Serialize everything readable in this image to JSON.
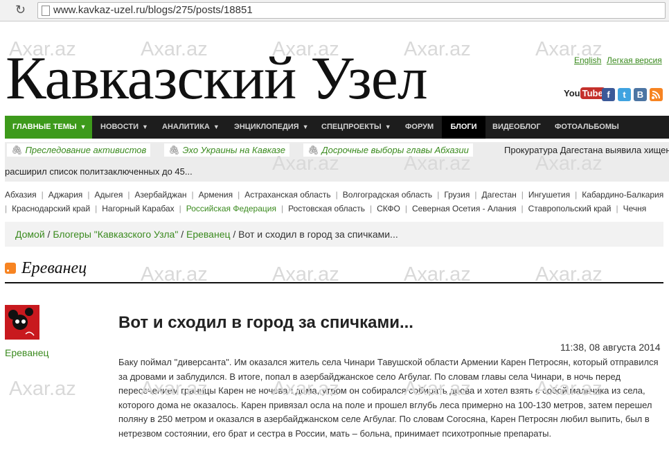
{
  "browser": {
    "url": "www.kavkaz-uzel.ru/blogs/275/posts/18851"
  },
  "watermark": "Axar.az",
  "header": {
    "logo": "Кавказский Узел",
    "lang_english": "English",
    "lang_light": "Легкая версия",
    "social": {
      "youtube_you": "You",
      "youtube_tube": "Tube",
      "facebook": "f",
      "twitter": "t",
      "vk": "B"
    }
  },
  "nav": {
    "items": [
      {
        "label": "ГЛАВНЫЕ ТЕМЫ"
      },
      {
        "label": "НОВОСТИ"
      },
      {
        "label": "АНАЛИТИКА"
      },
      {
        "label": "ЭНЦИКЛОПЕДИЯ"
      },
      {
        "label": "СПЕЦПРОЕКТЫ"
      },
      {
        "label": "ФОРУМ"
      },
      {
        "label": "БЛОГИ"
      },
      {
        "label": "ВИДЕОБЛОГ"
      },
      {
        "label": "ФОТОАЛЬБОМЫ"
      }
    ]
  },
  "ticker": {
    "tags": [
      "Преследование активистов",
      "Эхо Украины на Кавказе",
      "Досрочные выборы главы Абхазии"
    ],
    "news_line1": "Прокуратура Дагестана выявила хищен",
    "news_line2": "расширил список политзаключенных до 45..."
  },
  "regions": {
    "row1": [
      "Абхазия",
      "Аджария",
      "Адыгея",
      "Азербайджан",
      "Армения",
      "Астраханская область",
      "Волгоградская область",
      "Грузия",
      "Дагестан",
      "Ингушетия",
      "Кабардино-Балкария"
    ],
    "row2": [
      "Краснодарский край",
      "Нагорный Карабах",
      "Российская Федерация",
      "Ростовская область",
      "СКФО",
      "Северная Осетия - Алания",
      "Ставропольский край",
      "Чечня"
    ]
  },
  "breadcrumb": {
    "home": "Домой",
    "bloggers": "Блогеры \"Кавказского Узла\"",
    "blog": "Ереванец",
    "current": "Вот и сходил в город за спичками..."
  },
  "blog": {
    "title": "Ереванец"
  },
  "post": {
    "author": "Ереванец",
    "title": "Вот и сходил в город за спичками...",
    "date": "11:38, 08 августа 2014",
    "body": "Баку поймал \"диверсанта\". Им оказался житель села Чинари Тавушской области Армении Карен Петросян, который отправился за дровами и заблудился. В итоге, попал в азербайджанское село Агбулаг. По словам главы села Чинари, в ночь перед пересечением границы Карен не ночевал дома, утром он собирался собирать дрова и  хотел взять с собой мальчика из села, которого дома не оказалось. Карен привязал осла на поле и прошел вглубь  леса примерно на 100-130 метров, затем перешел поляну в 250 метром и оказался в азербайджанском селе Агбулаг. По словам Согосяна, Карен Петросян любил выпить, был в нетрезвом состоянии, его брат и сестра в России, мать – больна, принимает психотропные препараты."
  },
  "colors": {
    "green": "#3a8a1e",
    "nav_bg": "#1d1d1d",
    "nav_main": "#3d9a1b"
  }
}
